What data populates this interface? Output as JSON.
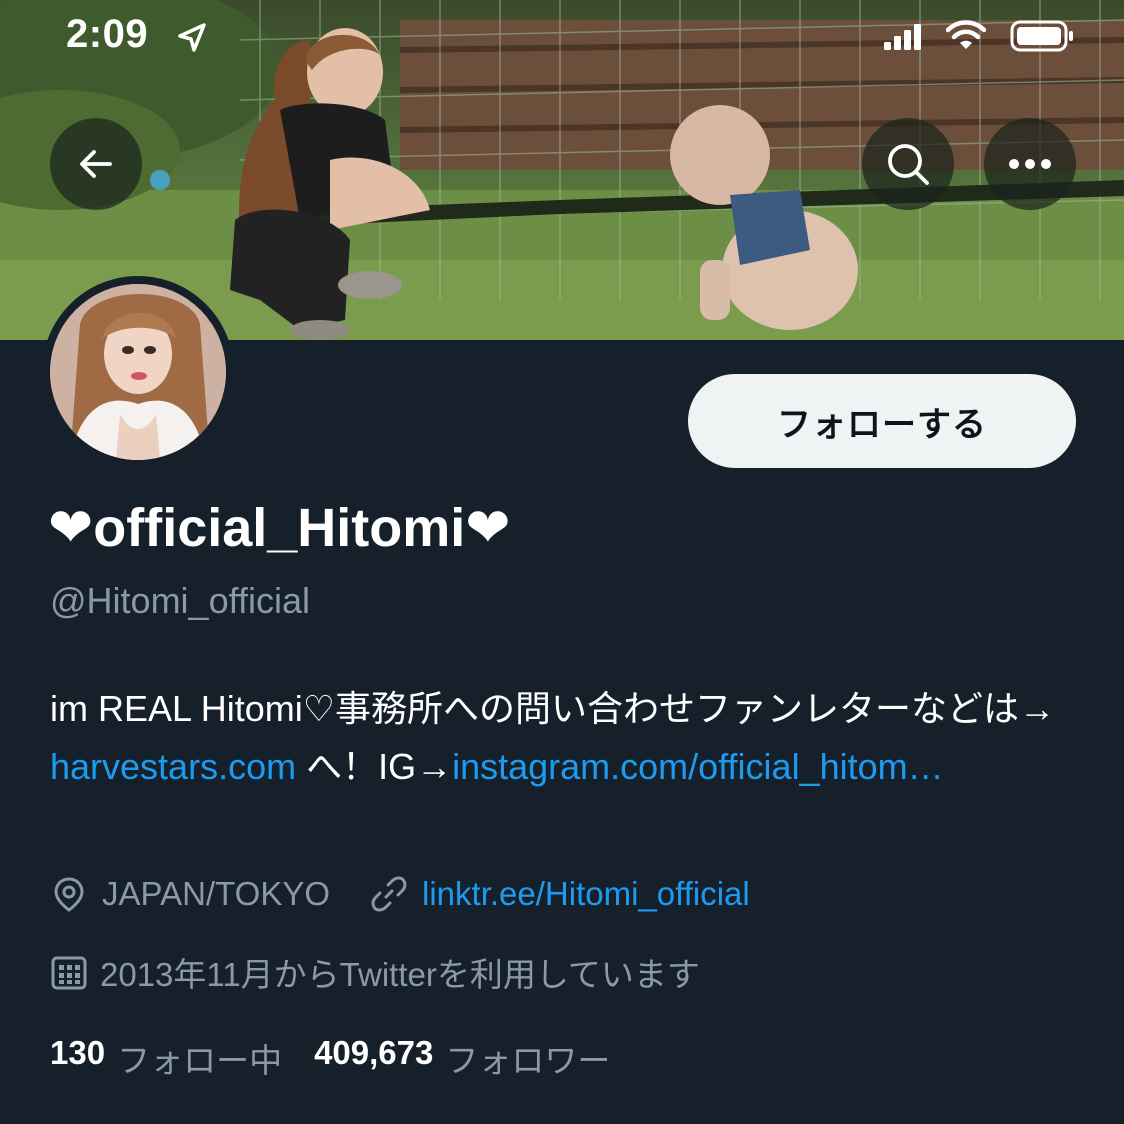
{
  "status_bar": {
    "time": "2:09",
    "icons": [
      "location-arrow-icon",
      "cellular-signal-icon",
      "wifi-icon",
      "battery-icon"
    ]
  },
  "header": {
    "back_icon": "arrow-left-icon",
    "search_icon": "search-icon",
    "more_icon": "more-dots-icon"
  },
  "profile": {
    "display_name": "❤official_Hitomi❤",
    "handle": "@Hitomi_official",
    "follow_label": "フォローする",
    "bio": {
      "text_1": "im REAL Hitomi♡事務所への問い合わせファンレターなどは→ ",
      "link_1": "harvestars.com",
      "text_2": " へ！IG→",
      "link_2": "instagram.com/official_hitom…"
    },
    "location": "JAPAN/TOKYO",
    "website": "linktr.ee/Hitomi_official",
    "joined": "2013年11月からTwitterを利用しています",
    "following_count": "130",
    "following_label": "フォロー中",
    "followers_count": "409,673",
    "followers_label": "フォロワー"
  },
  "colors": {
    "background": "#15202b",
    "text_primary": "#ffffff",
    "text_secondary": "#8b98a5",
    "link": "#1d9bf0",
    "follow_button_bg": "#eff3f4"
  }
}
